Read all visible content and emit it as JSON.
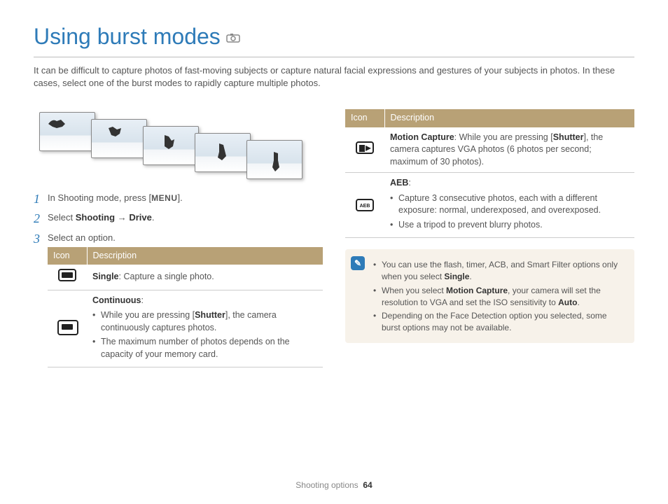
{
  "title": "Using burst modes",
  "intro": "It can be difficult to capture photos of fast-moving subjects or capture natural facial expressions and gestures of your subjects in photos. In these cases, select one of the burst modes to rapidly capture multiple photos.",
  "steps": {
    "s1_a": "In Shooting mode, press [",
    "s1_menu": "MENU",
    "s1_b": "].",
    "s2_a": "Select ",
    "s2_b": "Shooting",
    "s2_arrow": " → ",
    "s2_c": "Drive",
    "s2_d": ".",
    "s3": "Select an option."
  },
  "th_icon": "Icon",
  "th_desc": "Description",
  "left_rows": {
    "single_b": "Single",
    "single_t": ": Capture a single photo.",
    "cont_b": "Continuous",
    "cont_t": ":",
    "cont_l1a": "While you are pressing [",
    "cont_l1b": "Shutter",
    "cont_l1c": "], the camera continuously captures photos.",
    "cont_l2": "The maximum number of photos depends on the capacity of your memory card."
  },
  "right_rows": {
    "mc_b": "Motion Capture",
    "mc_t1": ": While you are pressing [",
    "mc_t2": "Shutter",
    "mc_t3": "], the camera captures VGA photos (6 photos per second; maximum of 30 photos).",
    "aeb_b": "AEB",
    "aeb_t": ":",
    "aeb_l1": "Capture 3 consecutive photos, each with a different exposure: normal, underexposed, and overexposed.",
    "aeb_l2": "Use a tripod to prevent blurry photos."
  },
  "note": {
    "n1a": "You can use the flash, timer, ACB, and Smart Filter options only when you select ",
    "n1b": "Single",
    "n1c": ".",
    "n2a": "When you select ",
    "n2b": "Motion Capture",
    "n2c": ", your camera will set the resolution to VGA and set the ISO sensitivity to ",
    "n2d": "Auto",
    "n2e": ".",
    "n3": "Depending on the Face Detection option you selected, some burst options may not be available."
  },
  "footer_section": "Shooting options",
  "footer_page": "64"
}
